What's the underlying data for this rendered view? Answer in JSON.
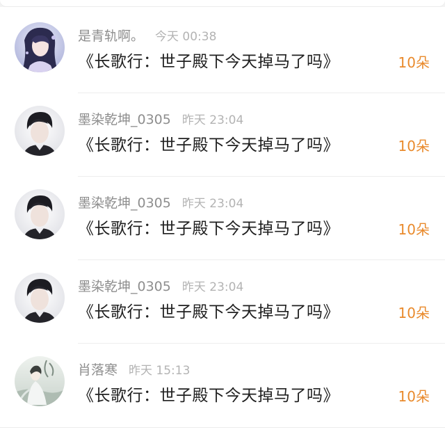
{
  "gifts": [
    {
      "username": "是青轨啊。",
      "time": "今天 00:38",
      "gift": "《长歌行：世子殿下今天掉马了吗》",
      "count": "10朵",
      "avatar": "girl-illustration-avatar"
    },
    {
      "username": "墨染乾坤_0305",
      "time": "昨天 23:04",
      "gift": "《长歌行：世子殿下今天掉马了吗》",
      "count": "10朵",
      "avatar": "young-man-portrait-avatar"
    },
    {
      "username": "墨染乾坤_0305",
      "time": "昨天 23:04",
      "gift": "《长歌行：世子殿下今天掉马了吗》",
      "count": "10朵",
      "avatar": "young-man-portrait-avatar"
    },
    {
      "username": "墨染乾坤_0305",
      "time": "昨天 23:04",
      "gift": "《长歌行：世子殿下今天掉马了吗》",
      "count": "10朵",
      "avatar": "young-man-portrait-avatar"
    },
    {
      "username": "肖落寒",
      "time": "昨天 15:13",
      "gift": "《长歌行：世子殿下今天掉马了吗》",
      "count": "10朵",
      "avatar": "ancient-style-painting-avatar"
    }
  ],
  "colors": {
    "count": "#e98a2c",
    "username": "#8e8e8e",
    "time": "#b3b3b3",
    "gift_title": "#1f1f1f"
  }
}
